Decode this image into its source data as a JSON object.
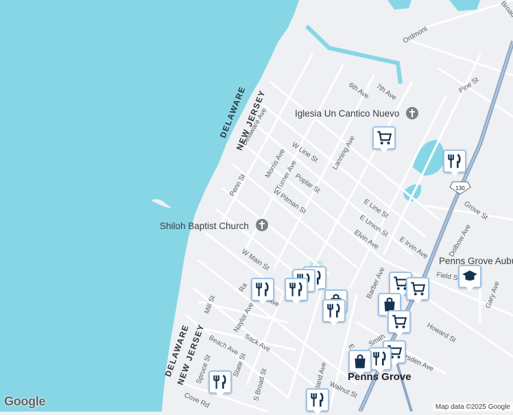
{
  "map": {
    "colors": {
      "water": "#87d6e6",
      "land": "#eef0f3",
      "road": "#ffffff",
      "highway": "#8ea8c6",
      "park": "#c8ebd0",
      "pin_border": "#9fc3e6",
      "pin_icon": "#16324f"
    },
    "state_labels": [
      {
        "key": "delaware_top",
        "text": "DELAWARE"
      },
      {
        "key": "nj_top",
        "text": "NEW JERSEY"
      },
      {
        "key": "delaware_bottom",
        "text": "DELAWARE"
      },
      {
        "key": "nj_bottom",
        "text": "NEW JERSEY"
      }
    ],
    "town_label": "Penns Grove",
    "highway_shield": "130",
    "places": [
      {
        "key": "iglesia",
        "name": "Iglesia Un Cantico Nuevo"
      },
      {
        "key": "shiloh",
        "name": "Shiloh Baptist Church"
      },
      {
        "key": "penns_grove_aub",
        "name": "Penns Grove Auburn"
      }
    ],
    "streets": [
      {
        "key": "broadway",
        "text": "Broadway"
      },
      {
        "key": "ordmont",
        "text": "Ordmont"
      },
      {
        "key": "6th",
        "text": "6th Ave"
      },
      {
        "key": "7th",
        "text": "7th Ave"
      },
      {
        "key": "pine",
        "text": "Pine St"
      },
      {
        "key": "delaware_ave",
        "text": "Delaware Ave"
      },
      {
        "key": "morris",
        "text": "Morris Ave"
      },
      {
        "key": "wline",
        "text": "W Line St"
      },
      {
        "key": "lanning",
        "text": "Lanning Ave"
      },
      {
        "key": "turner",
        "text": "Turner Ave"
      },
      {
        "key": "poplar",
        "text": "Poplar St"
      },
      {
        "key": "penn",
        "text": "Penn St"
      },
      {
        "key": "wpitman",
        "text": "W Pitman St"
      },
      {
        "key": "eline",
        "text": "E Line St"
      },
      {
        "key": "eunion",
        "text": "E Union St"
      },
      {
        "key": "elvin",
        "text": "Elvin Ave"
      },
      {
        "key": "eirvin",
        "text": "E Irvin Ave"
      },
      {
        "key": "wmain",
        "text": "W Main St"
      },
      {
        "key": "dolbow",
        "text": "Dolbow Ave"
      },
      {
        "key": "field",
        "text": "Field St"
      },
      {
        "key": "grove",
        "text": "Grove St"
      },
      {
        "key": "gary",
        "text": "Gary Ave"
      },
      {
        "key": "barber",
        "text": "Barber Ave"
      },
      {
        "key": "ra",
        "text": "Ra"
      },
      {
        "key": "naylor",
        "text": "Naylor Ave"
      },
      {
        "key": "mill",
        "text": "Mill St"
      },
      {
        "key": "ave",
        "text": "Ave"
      },
      {
        "key": "howard",
        "text": "Howard St"
      },
      {
        "key": "sack",
        "text": "Sack Ave"
      },
      {
        "key": "beach",
        "text": "Beach Ave"
      },
      {
        "key": "state",
        "text": "State St"
      },
      {
        "key": "spruce",
        "text": "Spruce St"
      },
      {
        "key": "sbroad",
        "text": "S Broad St"
      },
      {
        "key": "cumberland",
        "text": "berland Ave"
      },
      {
        "key": "walnut",
        "text": "Walnut St"
      },
      {
        "key": "smith",
        "text": "Smith"
      },
      {
        "key": "marsden",
        "text": "arsden Ave"
      },
      {
        "key": "cove",
        "text": "Cove Rd"
      },
      {
        "key": "em",
        "text": "E M"
      }
    ],
    "pins": [
      {
        "key": "grocery-1",
        "icon": "cart-icon"
      },
      {
        "key": "restaurant-1",
        "icon": "fork-knife-icon"
      },
      {
        "key": "school-1",
        "icon": "graduation-cap-icon"
      },
      {
        "key": "restaurant-2",
        "icon": "fork-knife-icon"
      },
      {
        "key": "restaurant-3",
        "icon": "fork-knife-icon"
      },
      {
        "key": "restaurant-4",
        "icon": "fork-knife-icon"
      },
      {
        "key": "restaurant-5",
        "icon": "fork-knife-icon"
      },
      {
        "key": "shopping-1",
        "icon": "shopping-bag-icon"
      },
      {
        "key": "grocery-2",
        "icon": "cart-icon"
      },
      {
        "key": "grocery-3",
        "icon": "cart-icon"
      },
      {
        "key": "shopping-2",
        "icon": "shopping-bag-icon"
      },
      {
        "key": "grocery-4",
        "icon": "cart-icon"
      },
      {
        "key": "grocery-5",
        "icon": "cart-icon"
      },
      {
        "key": "restaurant-6",
        "icon": "fork-knife-icon"
      },
      {
        "key": "shopping-3",
        "icon": "shopping-bag-icon"
      },
      {
        "key": "restaurant-7",
        "icon": "fork-knife-icon"
      },
      {
        "key": "restaurant-8",
        "icon": "fork-knife-icon"
      }
    ]
  },
  "footer": {
    "logo": "Google",
    "attribution": "Map data ©2025 Google"
  }
}
